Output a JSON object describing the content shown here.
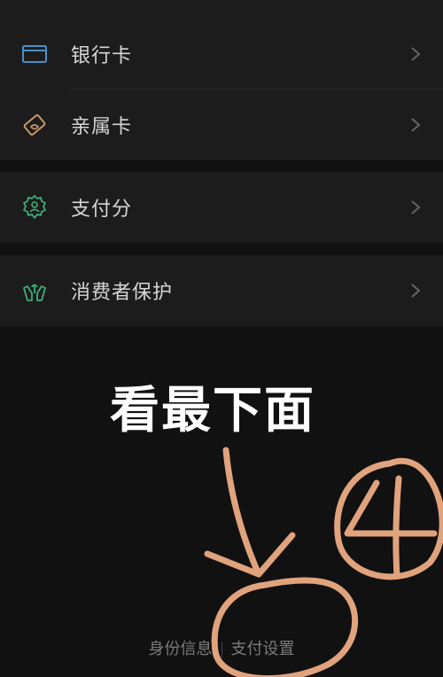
{
  "menu": {
    "items": [
      {
        "label": "银行卡",
        "icon": "bank-card-icon",
        "color": "#4a8fc6"
      },
      {
        "label": "亲属卡",
        "icon": "family-card-icon",
        "color": "#c9996a"
      },
      {
        "label": "支付分",
        "icon": "pay-score-icon",
        "color": "#3fae7a"
      },
      {
        "label": "消费者保护",
        "icon": "consumer-protection-icon",
        "color": "#3fae7a"
      }
    ]
  },
  "annotation": {
    "text": "看最下面",
    "stroke_color": "#e0a37c"
  },
  "footer": {
    "identity_label": "身份信息",
    "payment_settings_label": "支付设置"
  }
}
